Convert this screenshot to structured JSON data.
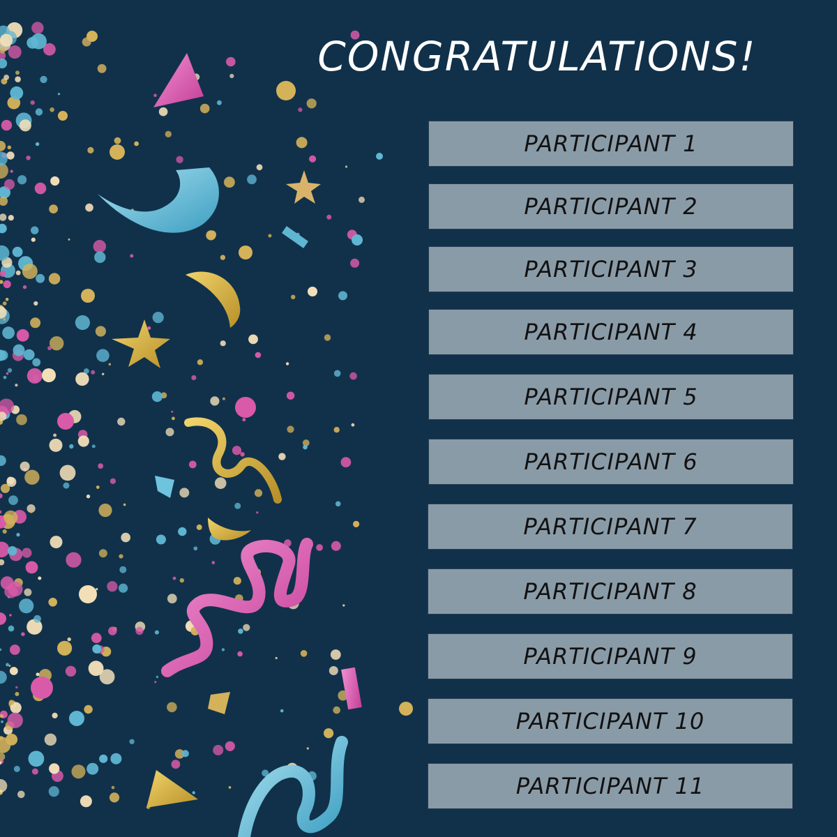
{
  "title": "CONGRATULATIONS!",
  "participants": [
    "PARTICIPANT 1",
    "PARTICIPANT 2",
    "PARTICIPANT 3",
    "PARTICIPANT 4",
    "PARTICIPANT 5",
    "PARTICIPANT 6",
    "PARTICIPANT 7",
    "PARTICIPANT 8",
    "PARTICIPANT 9",
    "PARTICIPANT 10",
    "PARTICIPANT 11"
  ],
  "colors": {
    "background": "#11314a",
    "box_fill": "#8a9ba8",
    "box_border": "#253e52",
    "title_text": "#ffffff",
    "box_text": "#111111",
    "confetti_gold": "#d4b25a",
    "confetti_pink": "#d85aa8",
    "confetti_blue": "#5fb6d2",
    "confetti_cream": "#f2dfb8"
  }
}
